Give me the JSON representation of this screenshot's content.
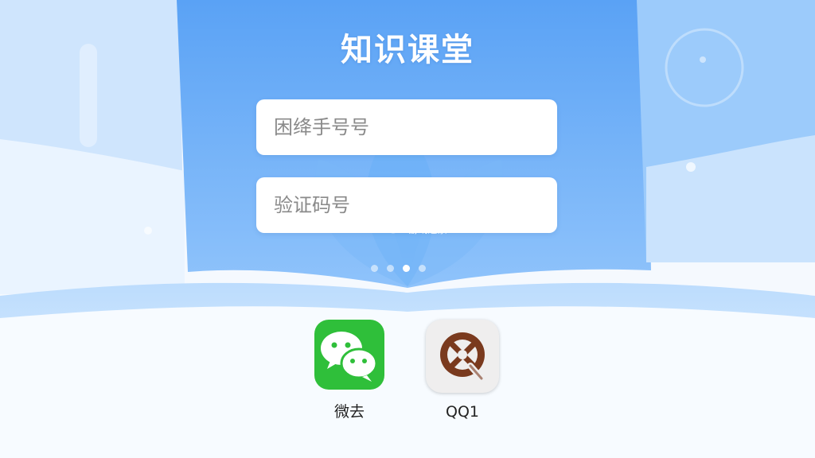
{
  "header": {
    "title": "知识课堂"
  },
  "form": {
    "phone_placeholder": "困绛手号号",
    "code_placeholder": "验证码号"
  },
  "pager": {
    "count": 4,
    "active_index": 2
  },
  "login_options": {
    "wechat_label": "微去",
    "qq_label": "QQ1"
  },
  "watermark": {
    "brand": "K73",
    "site": "游戏之家",
    "domain": ".com"
  },
  "colors": {
    "sky_blue": "#5ea6f5",
    "wechat_green": "#2fbf3a",
    "qq_brown": "#7a3a1e"
  }
}
